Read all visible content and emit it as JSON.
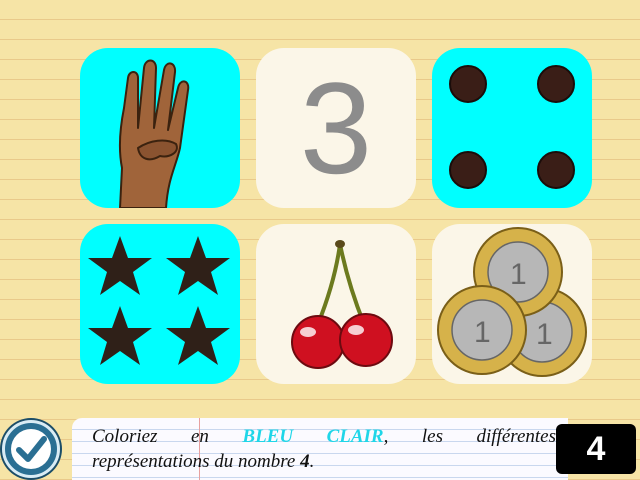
{
  "cards": {
    "numeral_value": "3"
  },
  "instruction": {
    "part1": "Coloriez en ",
    "highlight": "BLEU CLAIR",
    "part2": ", les différentes",
    "part3": "représentations du nombre ",
    "number": "4",
    "part4": "."
  },
  "counter": {
    "value": "4"
  },
  "colors": {
    "cyan": "#00ffff",
    "cream": "#fbf6e8",
    "background": "#f6e4a6",
    "highlight": "#1fd6e8"
  },
  "icons": [
    "hand-four-fingers-icon",
    "die-four-dots-icon",
    "star-icon",
    "cherries-icon",
    "euro-coin-icon",
    "checkmark-icon"
  ]
}
